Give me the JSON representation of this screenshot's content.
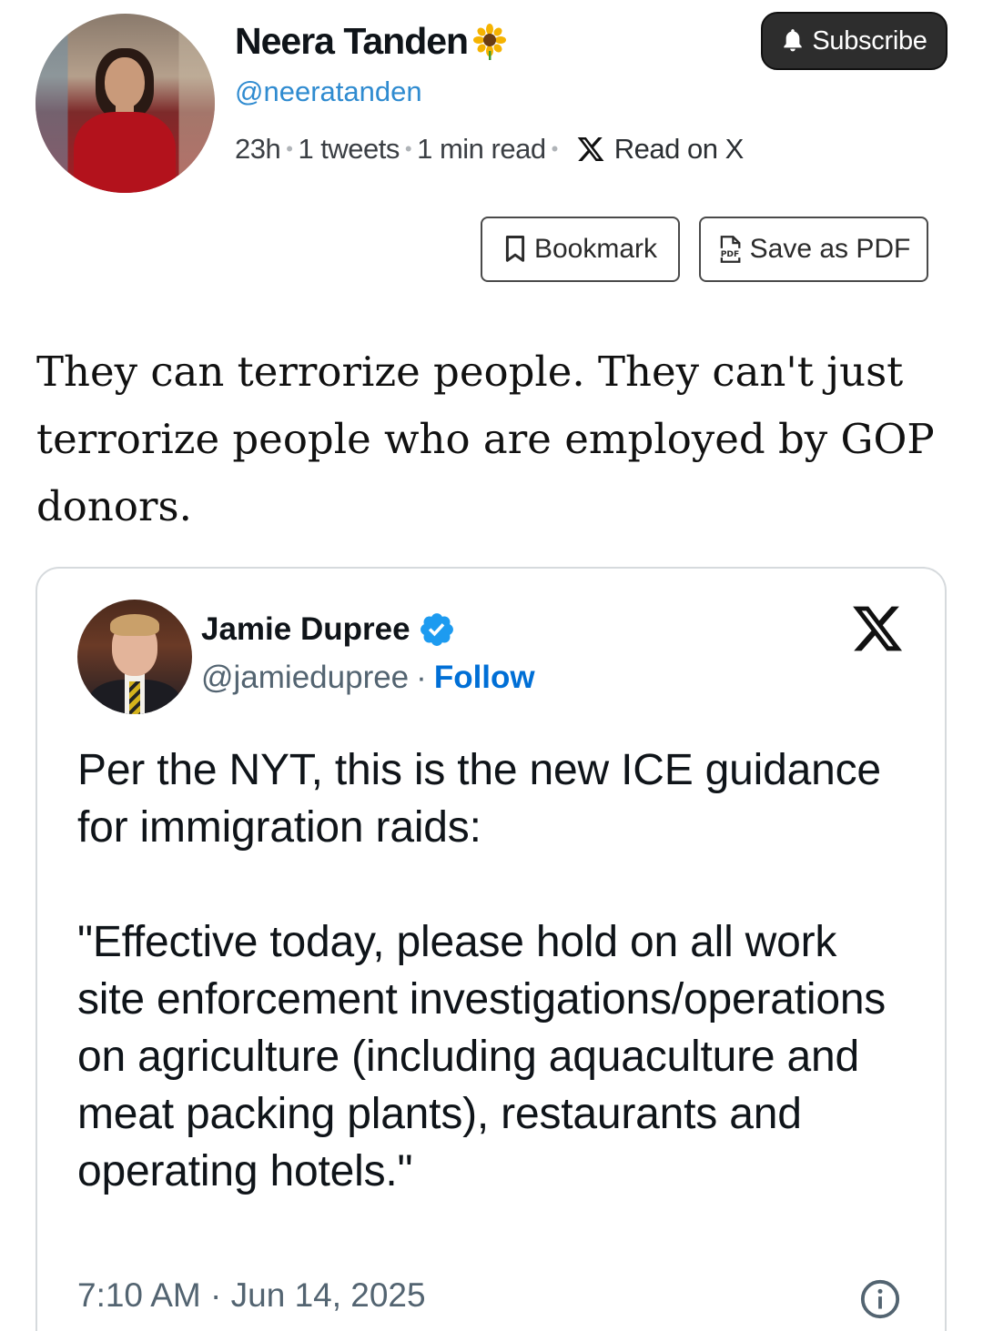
{
  "author": {
    "name": "Neera Tanden",
    "name_emoji": "🌻",
    "handle": "@neeratanden",
    "meta": {
      "age": "23h",
      "tweets": "1 tweets",
      "read_time": "1 min read",
      "read_on_x": "Read on X"
    }
  },
  "actions": {
    "subscribe_label": "Subscribe",
    "bookmark_label": "Bookmark",
    "pdf_label": "Save as PDF"
  },
  "post": {
    "text": "They can terrorize people. They can't just terrorize people who are employed by GOP donors."
  },
  "embed": {
    "name": "Jamie Dupree",
    "handle": "@jamiedupree",
    "separator": "·",
    "follow_label": "Follow",
    "paragraphs": [
      "Per the NYT, this is the new ICE guidance for immigration raids:",
      "\"Effective today, please hold on all work site enforcement investigations/operations on agriculture (including aquaculture and meat packing plants), restaurants and operating hotels.\""
    ],
    "timestamp": "7:10 AM · Jun 14, 2025"
  },
  "colors": {
    "handle_blue": "#2f8bd0",
    "follow_blue": "#006fd6",
    "verified_blue": "#1d9bf0",
    "subscribe_bg": "#2d2d2d"
  },
  "icons": [
    "bell-icon",
    "x-logo-icon",
    "bookmark-icon",
    "pdf-icon",
    "verified-badge-icon",
    "info-icon",
    "sunflower-icon"
  ]
}
